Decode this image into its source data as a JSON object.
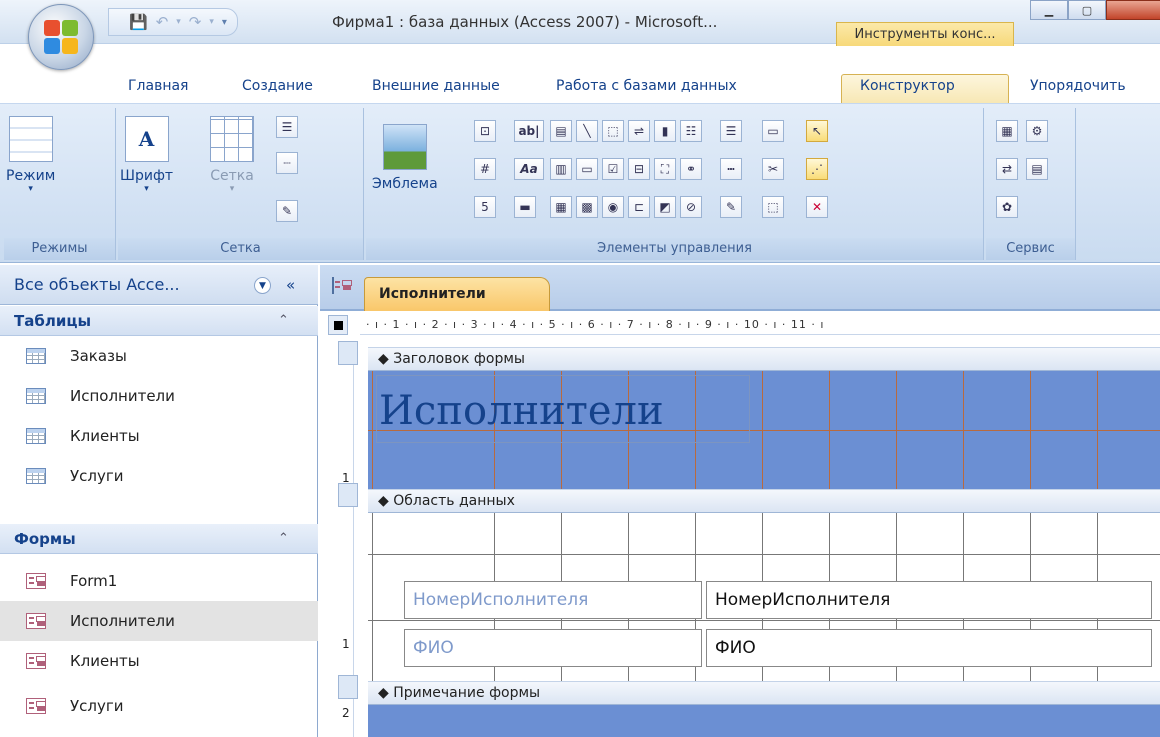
{
  "window": {
    "title": "Фирма1 : база данных (Access 2007) - Microsoft...",
    "context_tab": "Инструменты конс..."
  },
  "ribbon": {
    "tabs": [
      "Главная",
      "Создание",
      "Внешние данные",
      "Работа с базами данных",
      "Конструктор",
      "Упорядочить"
    ],
    "active_tab": "Конструктор",
    "groups": {
      "modes": {
        "label": "Режимы",
        "button": "Режим"
      },
      "grid": {
        "label": "Сетка",
        "font_button": "Шрифт",
        "grid_button": "Сетка"
      },
      "controls": {
        "label": "Элементы управления",
        "logo_button": "Эмблема"
      },
      "service": {
        "label": "Сервис"
      }
    },
    "icons": {
      "label_tool": "ab|",
      "text_tool": "Aa"
    }
  },
  "nav": {
    "header": "Все объекты Acce...",
    "sections": [
      {
        "title": "Таблицы",
        "items": [
          "Заказы",
          "Исполнители",
          "Клиенты",
          "Услуги"
        ]
      },
      {
        "title": "Формы",
        "items": [
          "Form1",
          "Исполнители",
          "Клиенты",
          "Услуги"
        ]
      }
    ],
    "selected": "Исполнители"
  },
  "document": {
    "tab_title": "Исполнители",
    "ruler": "· ı · 1 · ı · 2 · ı · 3 · ı · 4 · ı · 5 · ı · 6 · ı · 7 · ı · 8 · ı · 9 · ı · 10 · ı · 11 · ı",
    "sections": {
      "header": "Заголовок формы",
      "detail": "Область данных",
      "footer": "Примечание формы"
    },
    "form_title": "Исполнители",
    "fields": [
      {
        "label": "НомерИсполнителя",
        "control": "НомерИсполнителя"
      },
      {
        "label": "ФИО",
        "control": "ФИО"
      }
    ],
    "vruler_marks": [
      "1",
      "1",
      "2"
    ]
  },
  "colors": {
    "header_band": "#6b8fd3",
    "accent_tab": "#f9c76a",
    "grid_lines": "#b86a3f"
  }
}
